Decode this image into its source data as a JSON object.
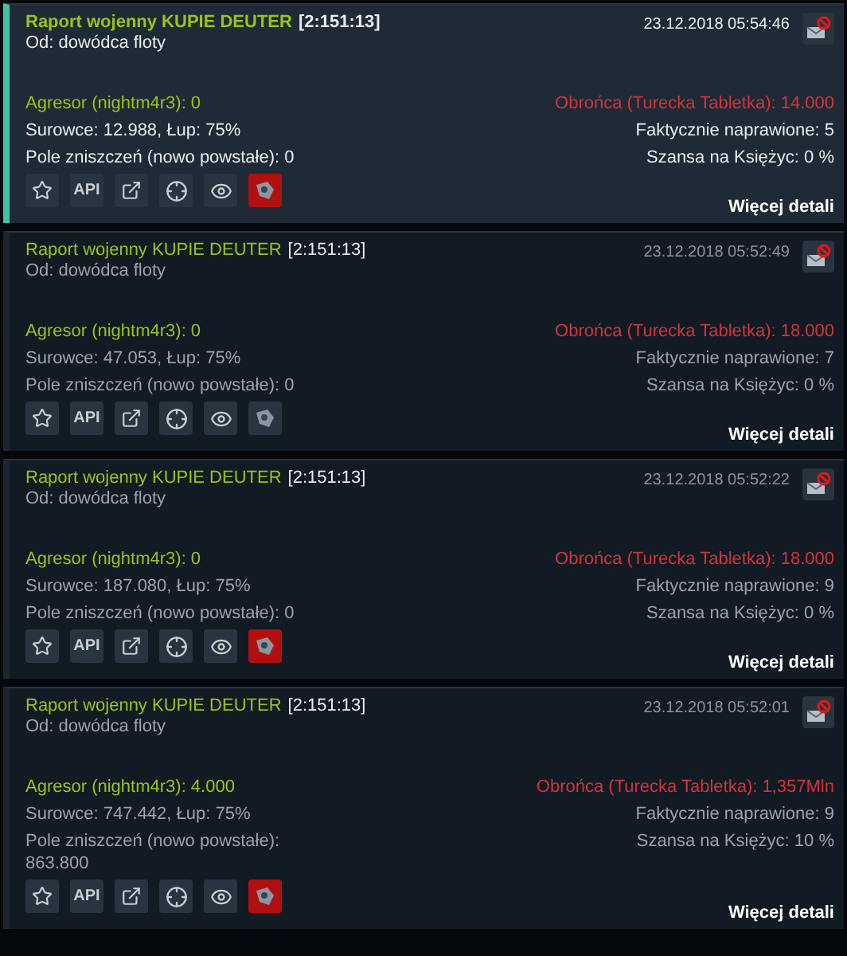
{
  "reports": [
    {
      "unread": true,
      "title": "Raport wojenny KUPIE DEUTER",
      "coords": "[2:151:13]",
      "date": "23.12.2018 05:54:46",
      "from": "Od: dowódca floty",
      "attacker": "Agresor (nightm4r3): 0",
      "defender": "Obrońca (Turecka Tabletka): 14.000",
      "resources": "Surowce: 12.988, Łup: 75%",
      "repaired": "Faktycznie naprawione: 5",
      "debris": "Pole zniszczeń (nowo powstałe): 0",
      "moon": "Szansa na Księżyc: 0 %",
      "sim_active": true,
      "api": "API",
      "more": "Więcej detali"
    },
    {
      "unread": false,
      "title": "Raport wojenny KUPIE DEUTER",
      "coords": "[2:151:13]",
      "date": "23.12.2018 05:52:49",
      "from": "Od: dowódca floty",
      "attacker": "Agresor (nightm4r3): 0",
      "defender": "Obrońca (Turecka Tabletka): 18.000",
      "resources": "Surowce: 47.053, Łup: 75%",
      "repaired": "Faktycznie naprawione: 7",
      "debris": "Pole zniszczeń (nowo powstałe): 0",
      "moon": "Szansa na Księżyc: 0 %",
      "sim_active": false,
      "api": "API",
      "more": "Więcej detali"
    },
    {
      "unread": false,
      "title": "Raport wojenny KUPIE DEUTER",
      "coords": "[2:151:13]",
      "date": "23.12.2018 05:52:22",
      "from": "Od: dowódca floty",
      "attacker": "Agresor (nightm4r3): 0",
      "defender": "Obrońca (Turecka Tabletka): 18.000",
      "resources": "Surowce: 187.080, Łup: 75%",
      "repaired": "Faktycznie naprawione: 9",
      "debris": "Pole zniszczeń (nowo powstałe): 0",
      "moon": "Szansa na Księżyc: 0 %",
      "sim_active": true,
      "api": "API",
      "more": "Więcej detali"
    },
    {
      "unread": false,
      "title": "Raport wojenny KUPIE DEUTER",
      "coords": "[2:151:13]",
      "date": "23.12.2018 05:52:01",
      "from": "Od: dowódca floty",
      "attacker": "Agresor (nightm4r3): 4.000",
      "defender": "Obrońca (Turecka Tabletka): 1,357Mln",
      "resources": "Surowce: 747.442, Łup: 75%",
      "repaired": "Faktycznie naprawione: 9",
      "debris": "Pole zniszczeń (nowo powstałe): 863.800",
      "moon": "Szansa na Księżyc: 10 %",
      "sim_active": true,
      "api": "API",
      "more": "Więcej detali"
    }
  ]
}
